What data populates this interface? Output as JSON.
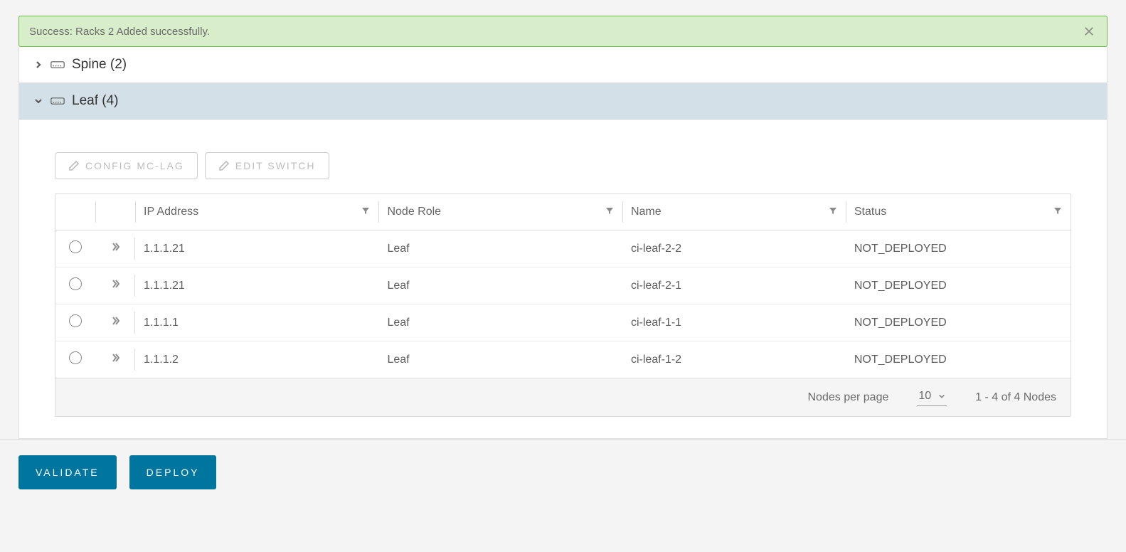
{
  "alert": {
    "message": "Success: Racks 2 Added successfully."
  },
  "groups": {
    "spine": {
      "label": "Spine (2)"
    },
    "leaf": {
      "label": "Leaf (4)"
    }
  },
  "toolbar": {
    "config_mc_lag": "CONFIG MC-LAG",
    "edit_switch": "EDIT SWITCH"
  },
  "columns": {
    "ip": "IP Address",
    "role": "Node Role",
    "name": "Name",
    "status": "Status"
  },
  "rows": [
    {
      "ip": "1.1.1.21",
      "role": "Leaf",
      "name": "ci-leaf-2-2",
      "status": "NOT_DEPLOYED"
    },
    {
      "ip": "1.1.1.21",
      "role": "Leaf",
      "name": "ci-leaf-2-1",
      "status": "NOT_DEPLOYED"
    },
    {
      "ip": "1.1.1.1",
      "role": "Leaf",
      "name": "ci-leaf-1-1",
      "status": "NOT_DEPLOYED"
    },
    {
      "ip": "1.1.1.2",
      "role": "Leaf",
      "name": "ci-leaf-1-2",
      "status": "NOT_DEPLOYED"
    }
  ],
  "pagination": {
    "per_page_label": "Nodes per page",
    "per_page_value": "10",
    "range_label": "1 - 4 of 4 Nodes"
  },
  "actions": {
    "validate": "VALIDATE",
    "deploy": "DEPLOY"
  }
}
